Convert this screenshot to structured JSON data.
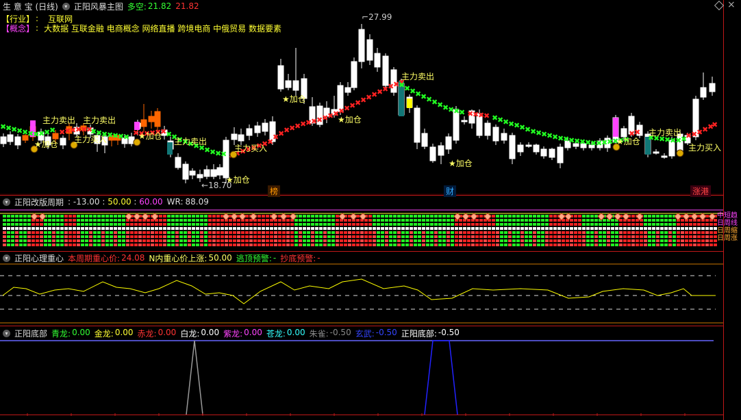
{
  "header": {
    "app": "生 意 宝 (日线)",
    "indicator": "正阳风暴主图",
    "dk_label": "多空:",
    "dk_green": "21.82",
    "dk_red": "21.82"
  },
  "info": {
    "industry_key": "【行业】",
    "industry_sep": ":",
    "industry_val": "互联网",
    "concept_key": "【概念】",
    "concept_sep": ":",
    "concept_val": "大数据 互联金融 电商概念 网络直播 跨境电商 中俄贸易 数据要素"
  },
  "main_chart": {
    "high_label": "27.99",
    "low_label": "18.70",
    "signals": {
      "sell": "主力卖出",
      "buy": "主力买入",
      "add": "加仓",
      "add2": "加仓"
    },
    "markers": [
      {
        "text": "榜",
        "color": "#ff9900"
      },
      {
        "text": "财",
        "color": "#33aaff"
      },
      {
        "text": "涨港",
        "color": "#ff4444"
      }
    ]
  },
  "panel2": {
    "title": "正阳改版周期",
    "v1": "-13.00",
    "v2": "50.00",
    "v3": "60.00",
    "wr_label": "WR:",
    "wr": "88.09",
    "side_labels": [
      "中短趋",
      "日周线",
      "日周缩",
      "日周涨"
    ]
  },
  "panel3": {
    "title": "正阳心理重心",
    "a_label": "本周期重心价:",
    "a_val": "24.08",
    "b_label": "N内重心价上涨:",
    "b_val": "50.00",
    "c_label": "逃顶预警:",
    "c_val": "-",
    "d_label": "抄底预警:",
    "d_val": "-"
  },
  "panel4": {
    "title": "正阳底部",
    "items": [
      {
        "label": "青龙:",
        "val": "0.00",
        "color": "#33ff33"
      },
      {
        "label": "金龙:",
        "val": "0.00",
        "color": "#ffff33"
      },
      {
        "label": "赤龙:",
        "val": "0.00",
        "color": "#ff3333"
      },
      {
        "label": "白龙:",
        "val": "0.00",
        "color": "#ffffff"
      },
      {
        "label": "紫龙:",
        "val": "0.00",
        "color": "#ff44ff"
      },
      {
        "label": "苍龙:",
        "val": "0.00",
        "color": "#33ffff"
      },
      {
        "label": "朱雀:",
        "val": "-0.50",
        "color": "#888888"
      },
      {
        "label": "玄武:",
        "val": "-0.50",
        "color": "#3344ff"
      },
      {
        "label": "正阳底部:",
        "val": "-0.50",
        "color": "#ffffff"
      }
    ]
  },
  "colors": {
    "up": "#ff6600",
    "down": "#ffffff",
    "line_red": "#ff2222",
    "line_green": "#22ff22",
    "yellow": "#ffff00",
    "panel_border": "#c01818"
  },
  "icons": [
    "collapse-circle-icon",
    "diamond-window-icon",
    "close-window-icon"
  ]
}
